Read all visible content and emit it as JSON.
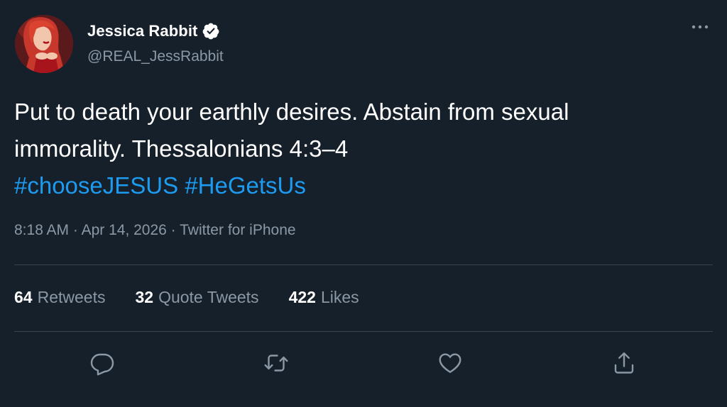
{
  "tweet": {
    "author": {
      "display_name": "Jessica Rabbit",
      "handle": "@REAL_JessRabbit",
      "verified": true
    },
    "text_lines": [
      "Put to death your earthly desires. Abstain from sexual",
      "immorality. Thessalonians 4:3–4"
    ],
    "hashtags": [
      "#chooseJESUS",
      "#HeGetsUs"
    ],
    "time": "8:18 AM",
    "date": "Apr 14, 2026",
    "source": "Twitter for iPhone",
    "separator": " · "
  },
  "stats": {
    "retweets": {
      "count": "64",
      "label": "Retweets"
    },
    "quote_tweets": {
      "count": "32",
      "label": "Quote Tweets"
    },
    "likes": {
      "count": "422",
      "label": "Likes"
    }
  },
  "icons": {
    "more": "more-horizontal-icon",
    "verified": "verified-badge-icon",
    "reply": "reply-icon",
    "retweet": "retweet-icon",
    "like": "heart-icon",
    "share": "share-icon"
  },
  "colors": {
    "background": "#15202b",
    "text_primary": "#ffffff",
    "text_secondary": "#8b98a5",
    "accent": "#1d9bf0",
    "divider": "#38444d"
  }
}
